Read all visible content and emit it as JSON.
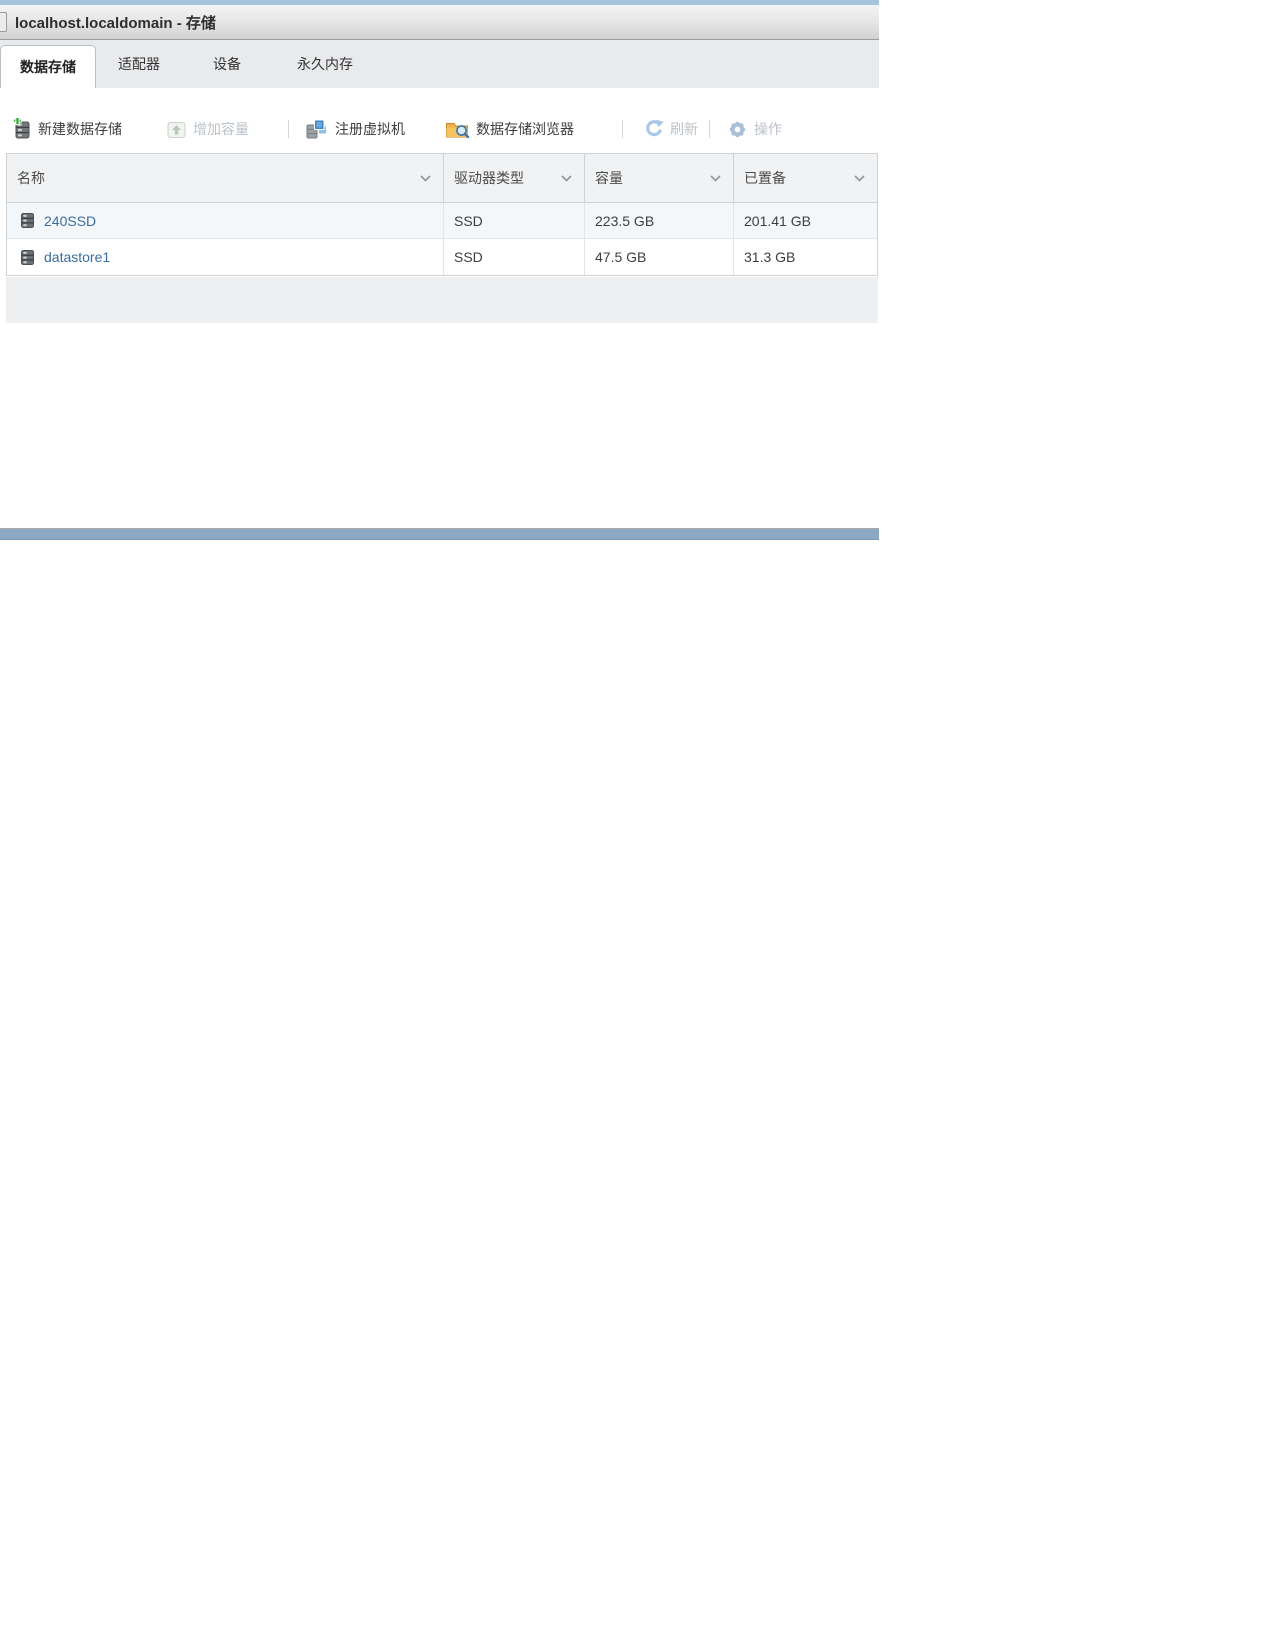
{
  "window": {
    "title": "localhost.localdomain - 存储"
  },
  "tabs": [
    {
      "label": "数据存储",
      "active": true
    },
    {
      "label": "适配器",
      "active": false
    },
    {
      "label": "设备",
      "active": false
    },
    {
      "label": "永久内存",
      "active": false
    }
  ],
  "toolbar": {
    "buttons": [
      {
        "label": "新建数据存储",
        "icon": "new-datastore-icon",
        "enabled": true
      },
      {
        "label": "增加容量",
        "icon": "increase-capacity-icon",
        "enabled": false
      },
      {
        "label": "注册虚拟机",
        "icon": "register-vm-icon",
        "enabled": true
      },
      {
        "label": "数据存储浏览器",
        "icon": "datastore-browser-icon",
        "enabled": true
      },
      {
        "label": "刷新",
        "icon": "refresh-icon",
        "enabled": false
      },
      {
        "label": "操作",
        "icon": "gear-icon",
        "enabled": false
      }
    ]
  },
  "table": {
    "columns": [
      "名称",
      "驱动器类型",
      "容量",
      "已置备"
    ],
    "rows": [
      {
        "name": "240SSD",
        "drive_type": "SSD",
        "capacity": "223.5 GB",
        "provisioned": "201.41 GB"
      },
      {
        "name": "datastore1",
        "drive_type": "SSD",
        "capacity": "47.5 GB",
        "provisioned": "31.3 GB"
      }
    ]
  },
  "colors": {
    "link_blue": "#3a6d9e",
    "splitter_blue": "#8da8c2",
    "top_strip_blue": "#a6c3de",
    "disabled_text": "#bcc2c8",
    "alt_row_bg": "#f4f7fa"
  }
}
